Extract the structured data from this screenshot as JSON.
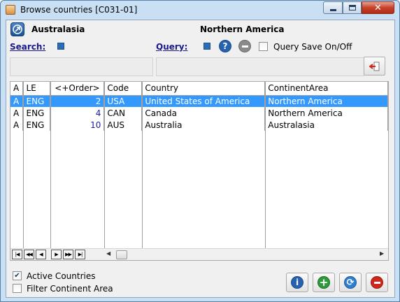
{
  "window": {
    "title": "Browse countries [C031-01]"
  },
  "header": {
    "current_continent": "Australasia",
    "selected_area": "Northern America",
    "search_label": "Search:",
    "query_label": "Query:",
    "query_save_label": "Query Save On/Off",
    "query_save_checked": false
  },
  "grid": {
    "columns": [
      "A",
      "LE",
      "<+Order>",
      "Code",
      "Country",
      "ContinentArea"
    ],
    "rows": [
      {
        "a": "A",
        "le": "ENG",
        "order": "2",
        "code": "USA",
        "country": "United States of America",
        "area": "Northern America",
        "selected": true
      },
      {
        "a": "A",
        "le": "ENG",
        "order": "4",
        "code": "CAN",
        "country": "Canada",
        "area": "Northern America",
        "selected": false
      },
      {
        "a": "A",
        "le": "ENG",
        "order": "10",
        "code": "AUS",
        "country": "Australia",
        "area": "Australasia",
        "selected": false
      }
    ]
  },
  "footer": {
    "active_countries_label": "Active Countries",
    "active_countries_checked": true,
    "filter_area_label": "Filter Continent Area",
    "filter_area_checked": false
  },
  "colors": {
    "selection": "#3399ff",
    "order_text": "#1a1aa8",
    "accent_blue": "#2b6cb8",
    "add_green": "#2e9a3c",
    "delete_red": "#d0261b"
  },
  "icons": [
    "navigate-icon",
    "help-icon",
    "clear-query-icon",
    "exit-icon",
    "info-icon",
    "add-icon",
    "refresh-icon",
    "delete-icon"
  ]
}
